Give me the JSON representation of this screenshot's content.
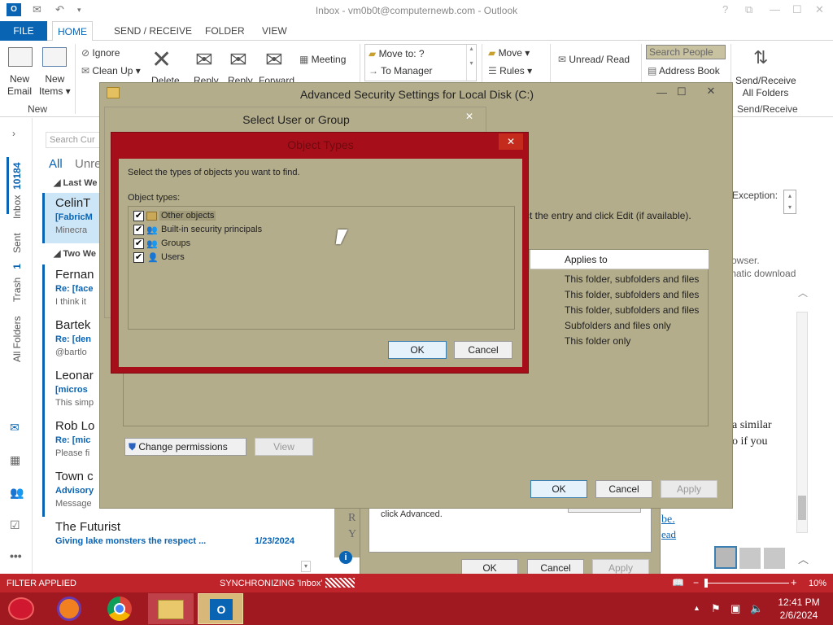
{
  "window": {
    "title": "Inbox - vm0b0t@computernewb.com - Outlook",
    "help": "?",
    "restore": "⧉",
    "minimize": "—",
    "maximize": "☐",
    "close": "✕"
  },
  "tabs": [
    "FILE",
    "HOME",
    "SEND / RECEIVE",
    "FOLDER",
    "VIEW"
  ],
  "ribbon": {
    "new_email": "New\nEmail",
    "new_items": "New\nItems ▾",
    "group_new": "New",
    "ignore": "Ignore",
    "clean_up": "Clean Up ▾",
    "delete": "Delete",
    "reply": "Reply",
    "reply_all": "Reply\nAll",
    "forward": "Forward",
    "meeting": "Meeting",
    "move_to": "Move to: ?",
    "to_manager": "To Manager",
    "move": "Move ▾",
    "rules": "Rules ▾",
    "unread_read": "Unread/ Read",
    "search_people": "Search People",
    "address_book": "Address Book",
    "send_receive_all": "Send/Receive\nAll Folders",
    "group_send_receive": "Send/Receive"
  },
  "rail": {
    "inbox": "Inbox",
    "inbox_count": "10184",
    "sent": "Sent",
    "trash": "Trash",
    "trash_count": "1",
    "all_folders": "All Folders"
  },
  "msglist": {
    "search_placeholder": "Search Cur",
    "filter_all": "All",
    "filter_unread": "Unre",
    "group_last_week": "Last We",
    "group_two_weeks": "Two We",
    "items": [
      {
        "from": "CelinT",
        "subj": "[FabricM",
        "prev": "Minecra",
        "date": ""
      },
      {
        "from": "Fernan",
        "subj": "Re: [face",
        "prev": "I think it",
        "date": ""
      },
      {
        "from": "Bartek",
        "subj": "Re: [den",
        "prev": "@bartlo",
        "date": ""
      },
      {
        "from": "Leonar",
        "subj": "[micros",
        "prev": "This simp",
        "date": ""
      },
      {
        "from": "Rob Lo",
        "subj": "Re: [mic",
        "prev": "Please fi",
        "date": ""
      },
      {
        "from": "Town c",
        "subj": "Advisory",
        "prev": "Message",
        "date": ""
      },
      {
        "from": "The Futurist",
        "subj": "Giving lake monsters the respect ...",
        "prev": "",
        "date": "1/23/2024"
      }
    ]
  },
  "reading": {
    "exception": "Exception:",
    "browser": "rowser.",
    "auto_download": "matic download",
    "similar": "a similar",
    "if_you": "o if you",
    "link1": "be.",
    "link2": "ead",
    "letter_r": "R",
    "letter_y": "Y"
  },
  "status": {
    "filter": "FILTER APPLIED",
    "sync": "SYNCHRONIZING  'Inbox'",
    "zoom": "10%"
  },
  "taskbar": {
    "time": "12:41 PM",
    "date": "2/6/2024"
  },
  "adv_security": {
    "title": "Advanced Security Settings for Local Disk (C:)",
    "instruction": "ct the entry and click Edit (if available).",
    "applies_to_header": "Applies to",
    "applies": [
      "This folder, subfolders and files",
      "This folder, subfolders and files",
      "This folder, subfolders and files",
      "Subfolders and files only",
      "This folder only"
    ],
    "change_permissions": "Change permissions",
    "view": "View",
    "ok": "OK",
    "cancel": "Cancel",
    "apply": "Apply"
  },
  "back_dialog": {
    "click_advanced": "click Advanced.",
    "ok": "OK",
    "cancel": "Cancel",
    "apply": "Apply"
  },
  "select_user": {
    "title": "Select User or Group"
  },
  "object_types": {
    "title": "Object Types",
    "prompt": "Select the types of objects you want to find.",
    "label": "Object types:",
    "items": [
      {
        "label": "Other objects",
        "checked": "✔"
      },
      {
        "label": "Built-in security principals",
        "checked": "✔"
      },
      {
        "label": "Groups",
        "checked": "✔"
      },
      {
        "label": "Users",
        "checked": "✔"
      }
    ],
    "ok": "OK",
    "cancel": "Cancel"
  },
  "colors": {
    "accent": "#0a64b4",
    "dialog_bg": "#b3ad8c",
    "active_border": "#a60f1a",
    "statusbar": "#c0242b"
  }
}
